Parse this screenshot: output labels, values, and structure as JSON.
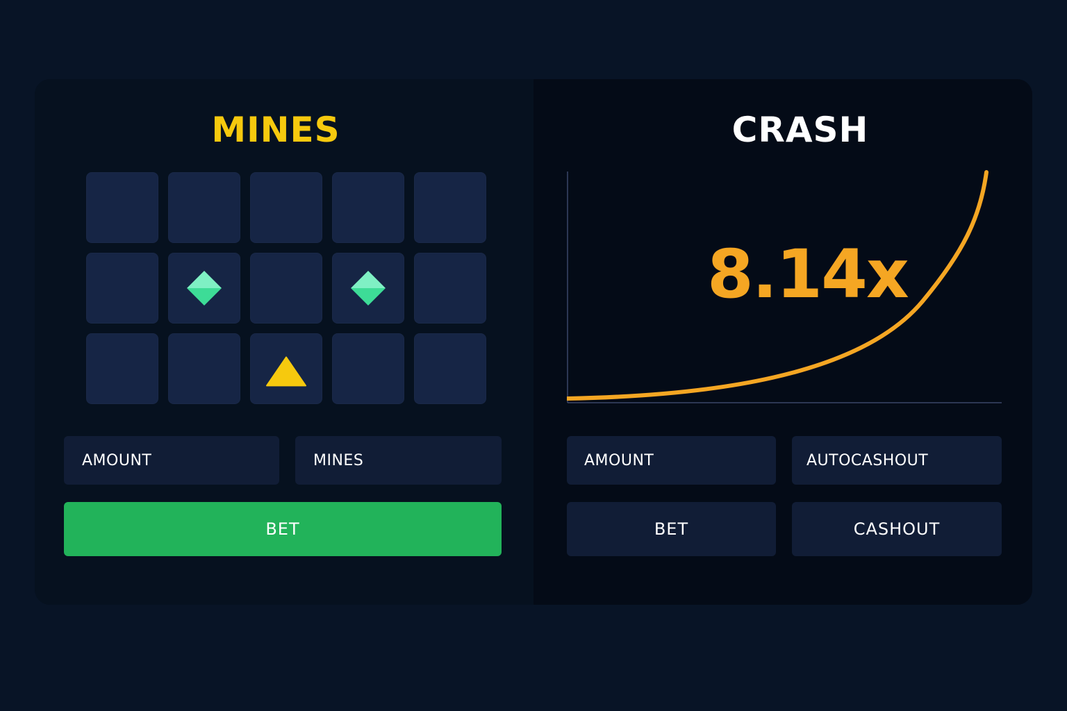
{
  "colors": {
    "page_bg": "#081426",
    "mines_title": "#f6c90e",
    "crash_title": "#ffffff",
    "tile": "#162545",
    "gem": "#3ddc97",
    "mine": "#f6c90e",
    "bet_green": "#22b35a",
    "curve": "#f5a623",
    "field_bg": "#111d36"
  },
  "mines": {
    "title": "MINES",
    "grid": {
      "rows": 3,
      "cols": 5,
      "tiles": [
        "hidden",
        "hidden",
        "hidden",
        "hidden",
        "hidden",
        "hidden",
        "gem",
        "hidden",
        "gem",
        "hidden",
        "hidden",
        "hidden",
        "mine",
        "hidden",
        "hidden"
      ]
    },
    "amount_label": "AMOUNT",
    "mines_label": "MINES",
    "bet_label": "BET"
  },
  "crash": {
    "title": "CRASH",
    "multiplier": "8.14x",
    "amount_label": "AMOUNT",
    "autocashout_label": "AUTOCASHOUT",
    "bet_label": "BET",
    "cashout_label": "CASHOUT"
  }
}
